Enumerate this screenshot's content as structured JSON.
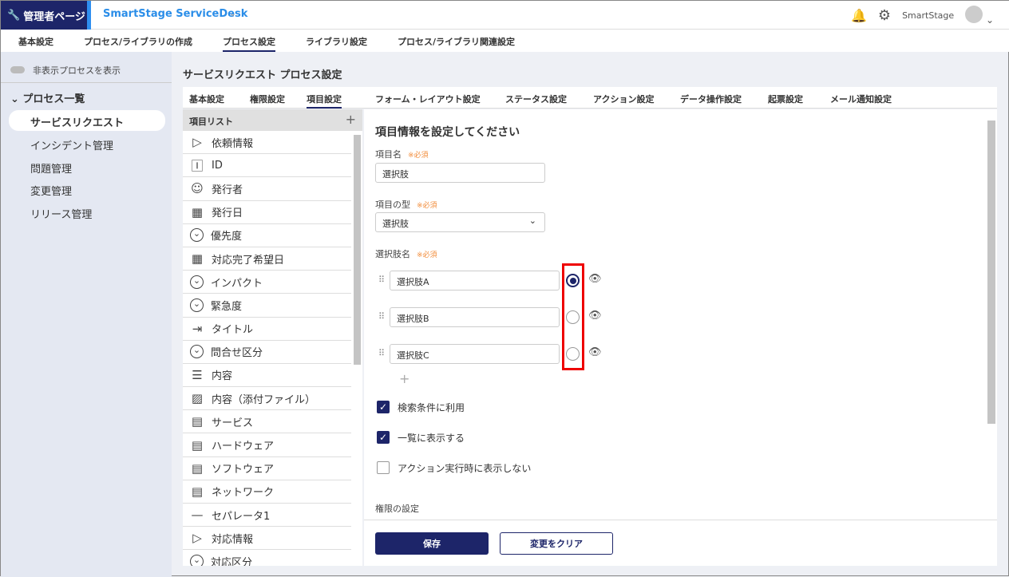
{
  "header": {
    "admin_label": "管理者ページ",
    "app_name": "SmartStage ServiceDesk",
    "user": "SmartStage"
  },
  "nav": [
    "基本設定",
    "プロセス/ライブラリの作成",
    "プロセス設定",
    "ライブラリ設定",
    "プロセス/ライブラリ関連設定"
  ],
  "sidebar": {
    "toggle_label": "非表示プロセスを表示",
    "group": "プロセス一覧",
    "items": [
      "サービスリクエスト",
      "インシデント管理",
      "問題管理",
      "変更管理",
      "リリース管理"
    ]
  },
  "page_title": "サービスリクエスト プロセス設定",
  "tabs": [
    "基本設定",
    "権限設定",
    "項目設定",
    "フォーム・レイアウト設定",
    "ステータス設定",
    "アクション設定",
    "データ操作設定",
    "起票設定",
    "メール通知設定"
  ],
  "item_list": {
    "title": "項目リスト",
    "items": [
      {
        "icon": "label",
        "label": "依頼情報"
      },
      {
        "icon": "id",
        "label": "ID"
      },
      {
        "icon": "person",
        "label": "発行者"
      },
      {
        "icon": "calendar",
        "label": "発行日"
      },
      {
        "icon": "chevron-circle",
        "label": "優先度"
      },
      {
        "icon": "calendar",
        "label": "対応完了希望日"
      },
      {
        "icon": "chevron-circle",
        "label": "インパクト"
      },
      {
        "icon": "chevron-circle",
        "label": "緊急度"
      },
      {
        "icon": "input",
        "label": "タイトル"
      },
      {
        "icon": "chevron-circle",
        "label": "問合せ区分"
      },
      {
        "icon": "lines",
        "label": "内容"
      },
      {
        "icon": "image",
        "label": "内容（添付ファイル）"
      },
      {
        "icon": "archive",
        "label": "サービス"
      },
      {
        "icon": "archive",
        "label": "ハードウェア"
      },
      {
        "icon": "archive",
        "label": "ソフトウェア"
      },
      {
        "icon": "archive",
        "label": "ネットワーク"
      },
      {
        "icon": "dash",
        "label": "セパレータ1"
      },
      {
        "icon": "label",
        "label": "対応情報"
      },
      {
        "icon": "chevron-circle",
        "label": "対応区分"
      }
    ]
  },
  "form": {
    "heading": "項目情報を設定してください",
    "required": "※必須",
    "name_label": "項目名",
    "name_value": "選択肢",
    "type_label": "項目の型",
    "type_value": "選択肢",
    "options_label": "選択肢名",
    "options": [
      {
        "label": "選択肢A",
        "default": true
      },
      {
        "label": "選択肢B",
        "default": false
      },
      {
        "label": "選択肢C",
        "default": false
      }
    ],
    "checkboxes": [
      {
        "label": "検索条件に利用",
        "checked": true
      },
      {
        "label": "一覧に表示する",
        "checked": true
      },
      {
        "label": "アクション実行時に表示しない",
        "checked": false
      }
    ],
    "permission_label": "権限の設定"
  },
  "buttons": {
    "save": "保存",
    "clear": "変更をクリア"
  }
}
